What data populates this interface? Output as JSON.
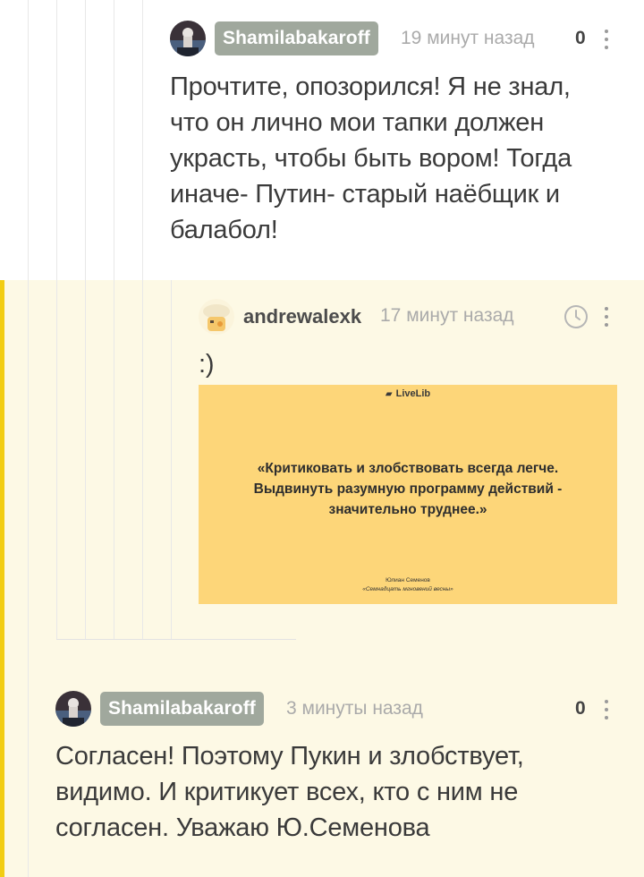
{
  "comments": [
    {
      "username": "Shamilabakaroff",
      "time": "19 минут назад",
      "rating": "0",
      "text": "Прочтите, опозорился! Я не знал, что он лично мои тапки должен украсть, чтобы быть вором! Тогда иначе- Путин- старый наёбщик и балабол!"
    },
    {
      "username": "andrewalexk",
      "time": "17 минут назад",
      "text": ":)",
      "quote_card": {
        "logo": "LiveLib",
        "quote": "«Критиковать и злобствовать всегда легче. Выдвинуть разумную программу действий - значительно труднее.»",
        "author": "Юлиан Семенов",
        "source": "«Семнадцать мгновений весны»"
      }
    },
    {
      "username": "Shamilabakaroff",
      "time": "3 минуты назад",
      "rating": "0",
      "text": "Согласен! Поэтому Пукин и злобствует, видимо. И критикует всех, кто с ним не согласен. Уважаю Ю.Семенова"
    }
  ],
  "colors": {
    "highlight_bg": "#fdf9e5",
    "highlight_bar": "#f2cd13",
    "badge_bg": "#a0a89d",
    "quote_bg": "#fdd679"
  },
  "icons": {
    "clock": "clock-icon",
    "more": "more-vertical-icon"
  }
}
